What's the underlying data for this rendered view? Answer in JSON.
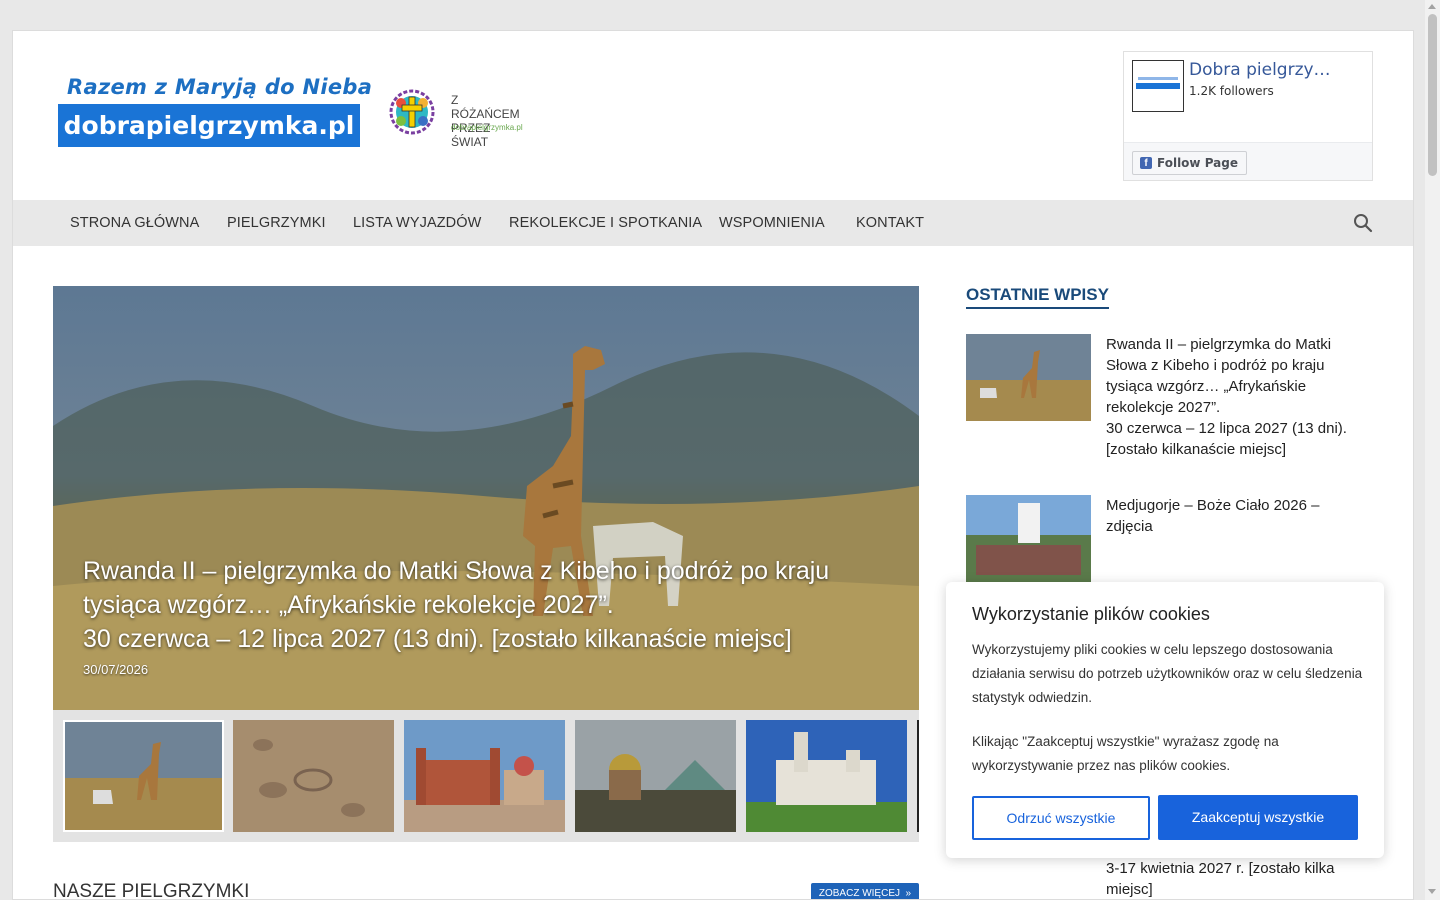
{
  "header": {
    "logo_tagline": "Razem z Maryją do Nieba",
    "logo_domain": "dobrapielgrzymka.pl",
    "logo2_line1": "Z RÓŻAŃCEM",
    "logo2_line2": "PRZEZ ŚWIAT",
    "logo2_line3": "dobrapielgrzymka.pl"
  },
  "facebook": {
    "page_name": "Dobra pielgrzy…",
    "followers": "1.2K followers",
    "follow_label": "Follow Page",
    "icon": "facebook-icon"
  },
  "nav": {
    "items": [
      "STRONA GŁÓWNA",
      "PIELGRZYMKI",
      "LISTA WYJAZDÓW",
      "REKOLEKCJE I SPOTKANIA",
      "WSPOMNIENIA",
      "KONTAKT"
    ],
    "search_icon": "search-icon"
  },
  "slider": {
    "title_lines": [
      "Rwanda II – pielgrzymka do Matki Słowa z Kibeho i podróż po kraju",
      "tysiąca wzgórz… „Afrykańskie rekolekcje 2027”.",
      "30 czerwca – 12 lipca 2027 (13 dni). [zostało kilkanaście miejsc]"
    ],
    "date": "30/07/2026"
  },
  "section": {
    "title": "NASZE PIELGRZYMKI",
    "more_label": "ZOBACZ WIĘCEJ"
  },
  "sidebar": {
    "title": "OSTATNIE WPISY",
    "posts": [
      {
        "lines": [
          "Rwanda II – pielgrzymka do Matki",
          "Słowa z Kibeho i podróż po kraju",
          "tysiąca wzgórz… „Afrykańskie",
          "rekolekcje 2027”.",
          "30 czerwca – 12 lipca 2027 (13 dni).",
          "[zostało kilkanaście miejsc]"
        ]
      },
      {
        "lines": [
          "Medjugorje – Boże Ciało 2026 –",
          "zdjęcia"
        ]
      }
    ],
    "tail_lines": [
      "3-17 kwietnia 2027 r. [zostało kilka",
      "miejsc]"
    ]
  },
  "cookie": {
    "title": "Wykorzystanie plików cookies",
    "text1": "Wykorzystujemy pliki cookies w celu lepszego dostosowania działania serwisu do potrzeb użytkowników oraz w celu śledzenia statystyk odwiedzin.",
    "text2": "Klikając \"Zaakceptuj wszystkie\" wyrażasz zgodę na wykorzystywanie przez nas plików cookies.",
    "reject_label": "Odrzuć wszystkie",
    "accept_label": "Zaakceptuj wszystkie"
  },
  "colors": {
    "accent": "#1863dc",
    "nav_bg": "#e8e8e8",
    "logo_blue": "#1a74d6",
    "sidebar_title": "#1a4a7a"
  }
}
